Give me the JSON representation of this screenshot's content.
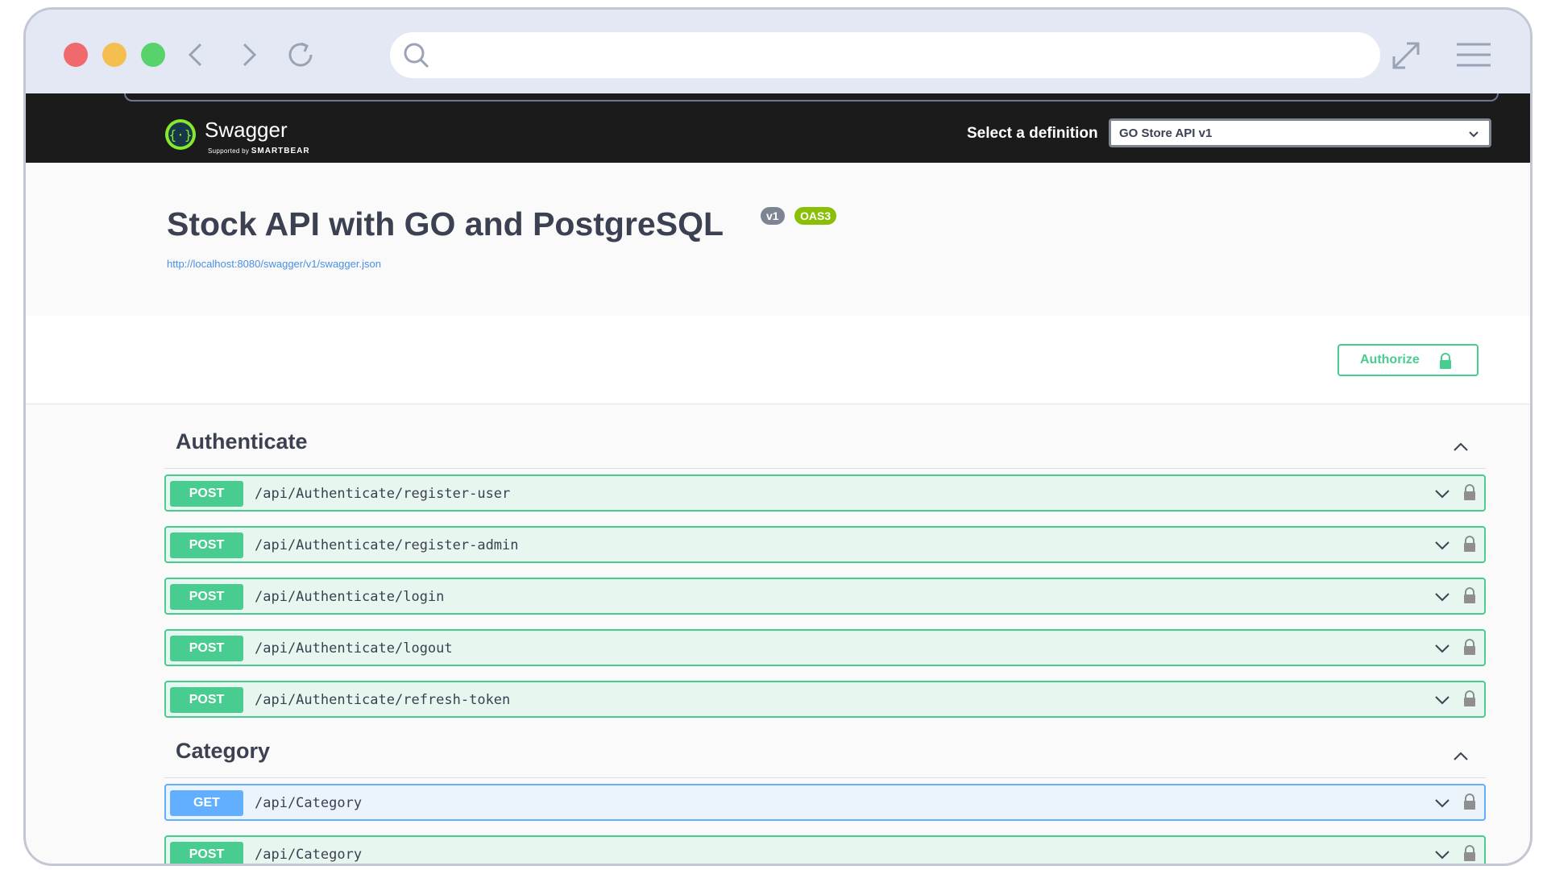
{
  "browser": {
    "url_value": "",
    "icons": [
      "back-icon",
      "forward-icon",
      "reload-icon",
      "search-icon",
      "expand-icon",
      "hamburger-menu-icon"
    ]
  },
  "topbar": {
    "logo_text": "Swagger",
    "logo_sub_prefix": "Supported by",
    "logo_sub_brand": "SMARTBEAR",
    "select_label": "Select a definition",
    "selected_definition": "GO Store API v1"
  },
  "info": {
    "title": "Stock API with GO and PostgreSQL",
    "version_badge": "v1",
    "oas_badge": "OAS3",
    "spec_url": "http://localhost:8080/swagger/v1/swagger.json"
  },
  "auth": {
    "authorize_label": "Authorize"
  },
  "sections": [
    {
      "name": "Authenticate",
      "operations": [
        {
          "method": "POST",
          "path": "/api/Authenticate/register-user"
        },
        {
          "method": "POST",
          "path": "/api/Authenticate/register-admin"
        },
        {
          "method": "POST",
          "path": "/api/Authenticate/login"
        },
        {
          "method": "POST",
          "path": "/api/Authenticate/logout"
        },
        {
          "method": "POST",
          "path": "/api/Authenticate/refresh-token"
        }
      ]
    },
    {
      "name": "Category",
      "operations": [
        {
          "method": "GET",
          "path": "/api/Category"
        },
        {
          "method": "POST",
          "path": "/api/Category"
        }
      ]
    }
  ],
  "colors": {
    "post": "#49cc90",
    "get": "#61affe",
    "topbar": "#1b1b1b",
    "badge_v": "#7d8492",
    "badge_oas": "#89bf04"
  }
}
